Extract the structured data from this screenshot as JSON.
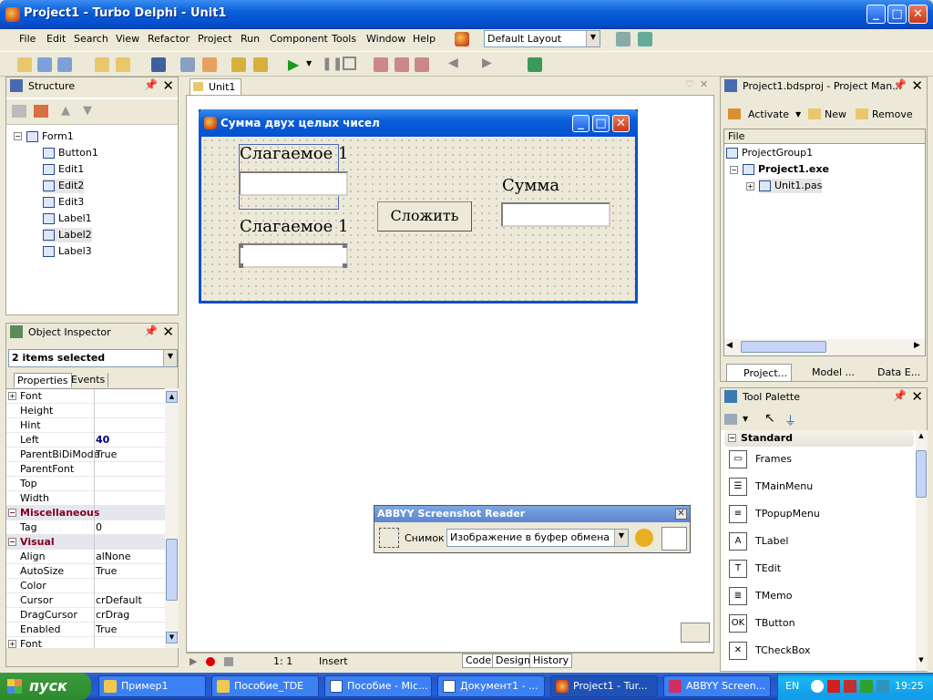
{
  "window": {
    "title": "Project1 - Turbo Delphi - Unit1"
  },
  "menu": [
    "File",
    "Edit",
    "Search",
    "View",
    "Refactor",
    "Project",
    "Run",
    "Component",
    "Tools",
    "Window",
    "Help"
  ],
  "layout_combo": "Default Layout",
  "structure": {
    "title": "Structure",
    "items": [
      "Form1",
      "Button1",
      "Edit1",
      "Edit2",
      "Edit3",
      "Label1",
      "Label2",
      "Label3"
    ]
  },
  "object_inspector": {
    "title": "Object Inspector",
    "selection": "2 items selected",
    "tabs": [
      "Properties",
      "Events"
    ],
    "rows": [
      {
        "name": "Font",
        "value": "",
        "type": "expand"
      },
      {
        "name": "Height",
        "value": ""
      },
      {
        "name": "Hint",
        "value": ""
      },
      {
        "name": "Left",
        "value": "40",
        "bold": true
      },
      {
        "name": "ParentBiDiMode",
        "value": "True"
      },
      {
        "name": "ParentFont",
        "value": ""
      },
      {
        "name": "Top",
        "value": ""
      },
      {
        "name": "Width",
        "value": ""
      },
      {
        "name": "Miscellaneous",
        "value": "",
        "type": "category"
      },
      {
        "name": "Tag",
        "value": "0"
      },
      {
        "name": "Visual",
        "value": "",
        "type": "category"
      },
      {
        "name": "Align",
        "value": "alNone"
      },
      {
        "name": "AutoSize",
        "value": "True"
      },
      {
        "name": "Color",
        "value": ""
      },
      {
        "name": "Cursor",
        "value": "crDefault"
      },
      {
        "name": "DragCursor",
        "value": "crDrag"
      },
      {
        "name": "Enabled",
        "value": "True"
      },
      {
        "name": "Font",
        "value": "",
        "type": "expand"
      }
    ]
  },
  "editor_tab": "Unit1",
  "form": {
    "caption": "Сумма двух целых чисел",
    "label1": "Слагаемое 1",
    "label2": "Слагаемое 1",
    "label3": "Сумма",
    "button": "Сложить"
  },
  "status": {
    "position": "1:   1",
    "mode": "Insert",
    "tabs": [
      "Code",
      "Design",
      "History"
    ]
  },
  "project_manager": {
    "title": "Project1.bdsproj - Project Man...",
    "actions": [
      "Activate",
      "New",
      "Remove"
    ],
    "column": "File",
    "items": [
      "ProjectGroup1",
      "Project1.exe",
      "Unit1.pas"
    ],
    "bottom_tabs": [
      "Project...",
      "Model ...",
      "Data E..."
    ]
  },
  "tool_palette": {
    "title": "Tool Palette",
    "category": "Standard",
    "items": [
      "Frames",
      "TMainMenu",
      "TPopupMenu",
      "TLabel",
      "TEdit",
      "TMemo",
      "TButton",
      "TCheckBox"
    ]
  },
  "abbyy": {
    "title": "ABBYY Screenshot Reader",
    "label": "Снимок",
    "option": "Изображение в буфер обмена"
  },
  "taskbar": {
    "start": "пуск",
    "tasks": [
      "Пример1",
      "Пособие_TDE",
      "Пособие - Mic...",
      "Документ1 - ...",
      "Project1 - Tur...",
      "ABBYY Screen..."
    ],
    "lang": "EN",
    "clock": "19:25"
  }
}
